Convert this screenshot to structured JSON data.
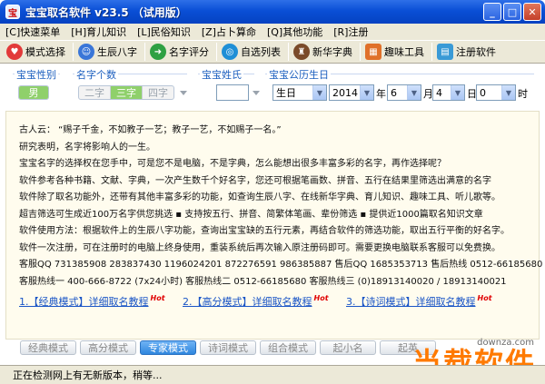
{
  "window": {
    "title": "宝宝取名软件 v23.5 （试用版）"
  },
  "menu": [
    "[C]快速菜单",
    "[H]育儿知识",
    "[L]民俗知识",
    "[Z]占卜算命",
    "[Q]其他功能",
    "[R]注册"
  ],
  "toolbar": [
    {
      "label": "模式选择",
      "icon": "heart-icon",
      "color": "#e23a3a"
    },
    {
      "label": "生辰八字",
      "icon": "person-icon",
      "color": "#3a76d8"
    },
    {
      "label": "名字评分",
      "icon": "arrow-right-icon",
      "color": "#2ea043"
    },
    {
      "label": "自选列表",
      "icon": "globe-icon",
      "color": "#1f8fd6"
    },
    {
      "label": "新华字典",
      "icon": "scholar-icon",
      "color": "#7a4a2a"
    },
    {
      "label": "趣味工具",
      "icon": "windows-icon",
      "color": "#e0702a"
    },
    {
      "label": "注册软件",
      "icon": "register-icon",
      "color": "#3a9ad6"
    }
  ],
  "options": {
    "gender_label": "宝宝性别",
    "gender_value": "男",
    "count_label": "名字个数",
    "counts": [
      "二字",
      "三字",
      "四字"
    ],
    "count_selected": 1,
    "surname_label": "宝宝姓氏",
    "surname_value": "",
    "birth_label": "宝宝公历生日",
    "calendar_type": "生日",
    "year": "2014",
    "month": "6",
    "day": "4",
    "hour": "0",
    "unit_year": "年",
    "unit_month": "月",
    "unit_day": "日",
    "unit_hour": "时"
  },
  "content": {
    "lines": [
      "古人云：  “赐子千金，不如教子一艺；教子一艺，不如赐子一名。”",
      "研究表明，名字将影响人的一生。",
      "宝宝名字的选择权在您手中，可是您不是电脑，不是字典，怎么能想出很多丰富多彩的名字，再作选择呢？",
      "软件参考各种书籍、文献、字典，一次产生数千个好名字，您还可根据笔画数、拼音、五行在结果里筛选出满意的名字",
      "软件除了取名功能外，还带有其他丰富多彩的功能，如查询生辰八字、在线新华字典、育儿知识、趣味工具、听儿歌等。",
      "超吉筛选可生成近100万名字供您挑选   ▪  支持按五行、拼音、简繁体笔画、辈份筛选  ▪  提供近1000篇取名知识文章",
      "软件使用方法：根据软件上的生辰八字功能，查询出宝宝缺的五行元素，再结合软件的筛选功能，取出五行平衡的好名字。",
      "软件一次注册，可在注册时的电脑上终身使用，重装系统后再次输入原注册码即可。需要更换电脑联系客服可以免费换。",
      "客服QQ 731385908   283837430   1196024201   872276591   986385887   售后QQ 1685353713   售后热线  0512-66185680",
      "客服热线一  400-666-8722  (7x24小时)   客服热线二  0512-66185680    客服热线三  (0)18913140020 / 18913140021"
    ],
    "links": [
      "1.【经典模式】详细取名教程",
      "2.【高分模式】详细取名教程",
      "3.【诗词模式】详细取名教程"
    ],
    "hot": "Hot"
  },
  "modes": [
    "经典模式",
    "高分模式",
    "专家模式",
    "诗词模式",
    "组合模式",
    "起小名",
    "起英"
  ],
  "mode_selected": 2,
  "status": "正在检测网上有无新版本，稍等...",
  "watermark": {
    "small": "downza.com",
    "big": "当载软件"
  }
}
